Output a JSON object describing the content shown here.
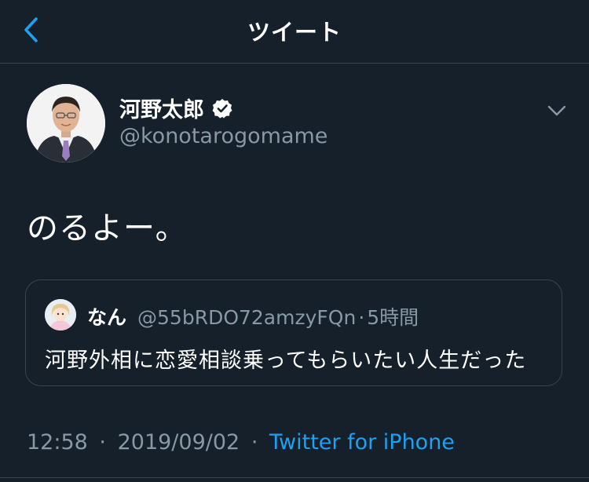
{
  "header": {
    "title": "ツイート",
    "back_icon": "chevron-left-icon"
  },
  "tweet": {
    "author": {
      "display_name": "河野太郎",
      "handle": "@konotarogomame",
      "verified": true
    },
    "text": "のるよー。",
    "quoted": {
      "display_name": "なん",
      "handle": "@55bRDO72amzyFQn",
      "separator": "·",
      "time": "5時間",
      "text": "河野外相に恋愛相談乗ってもらいたい人生だった"
    },
    "time": "12:58",
    "date": "2019/09/02",
    "separator": "·",
    "source": "Twitter for iPhone"
  },
  "colors": {
    "background": "#15202b",
    "accent": "#1da1f2",
    "secondary_text": "#8899a6",
    "divider": "#38444d"
  }
}
